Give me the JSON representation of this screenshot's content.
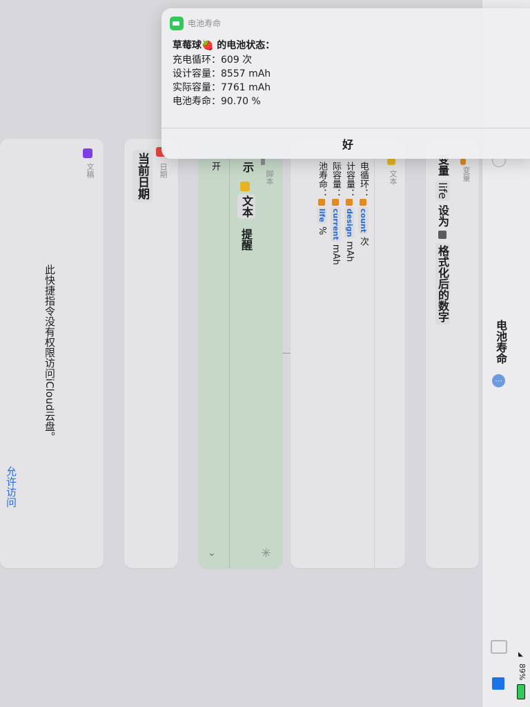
{
  "notification": {
    "app_name": "电池寿命",
    "title_prefix": "草莓球",
    "title_emoji": "🍓",
    "title_suffix": " 的电池状态：",
    "lines": [
      "充电循环：609  次",
      "设计容量：8557 mAh",
      "实际容量：7761 mAh",
      "电池寿命：90.70 %"
    ],
    "ok_label": "好"
  },
  "cards": {
    "document": {
      "tag": "文稿",
      "message": "此快捷指令没有权限访问iCloud云盘。",
      "allow_label": "允许访问",
      "tag_color": "#7b3fe4"
    },
    "date": {
      "tag": "日期",
      "value": "当前日期",
      "tag_color": "#e5453c"
    },
    "script": {
      "tag": "脚本",
      "text1": "示",
      "var_label": "文本",
      "text2": "提醒",
      "open_label": "开",
      "bg_color": "#c6d8c8"
    },
    "text": {
      "tag": "文本",
      "rows": [
        {
          "label": "电循环：",
          "var": "count",
          "unit": "次"
        },
        {
          "label": "计容量：",
          "var": "design",
          "unit": "mAh"
        },
        {
          "label": "际容量：",
          "var": "current",
          "unit": "mAh"
        },
        {
          "label": "池寿命：",
          "var": "life",
          "unit": "%"
        }
      ]
    },
    "variable": {
      "tag": "变量",
      "text1": "变量",
      "var_name": "life",
      "text2": "设为",
      "value": "格式化后的数字"
    }
  },
  "sidebar": {
    "title": "电池寿命",
    "battery_percent": "89%",
    "accent": "#1a73e8"
  },
  "colors": {
    "link": "#2a6bd8",
    "var_orange": "#e08a1f"
  }
}
